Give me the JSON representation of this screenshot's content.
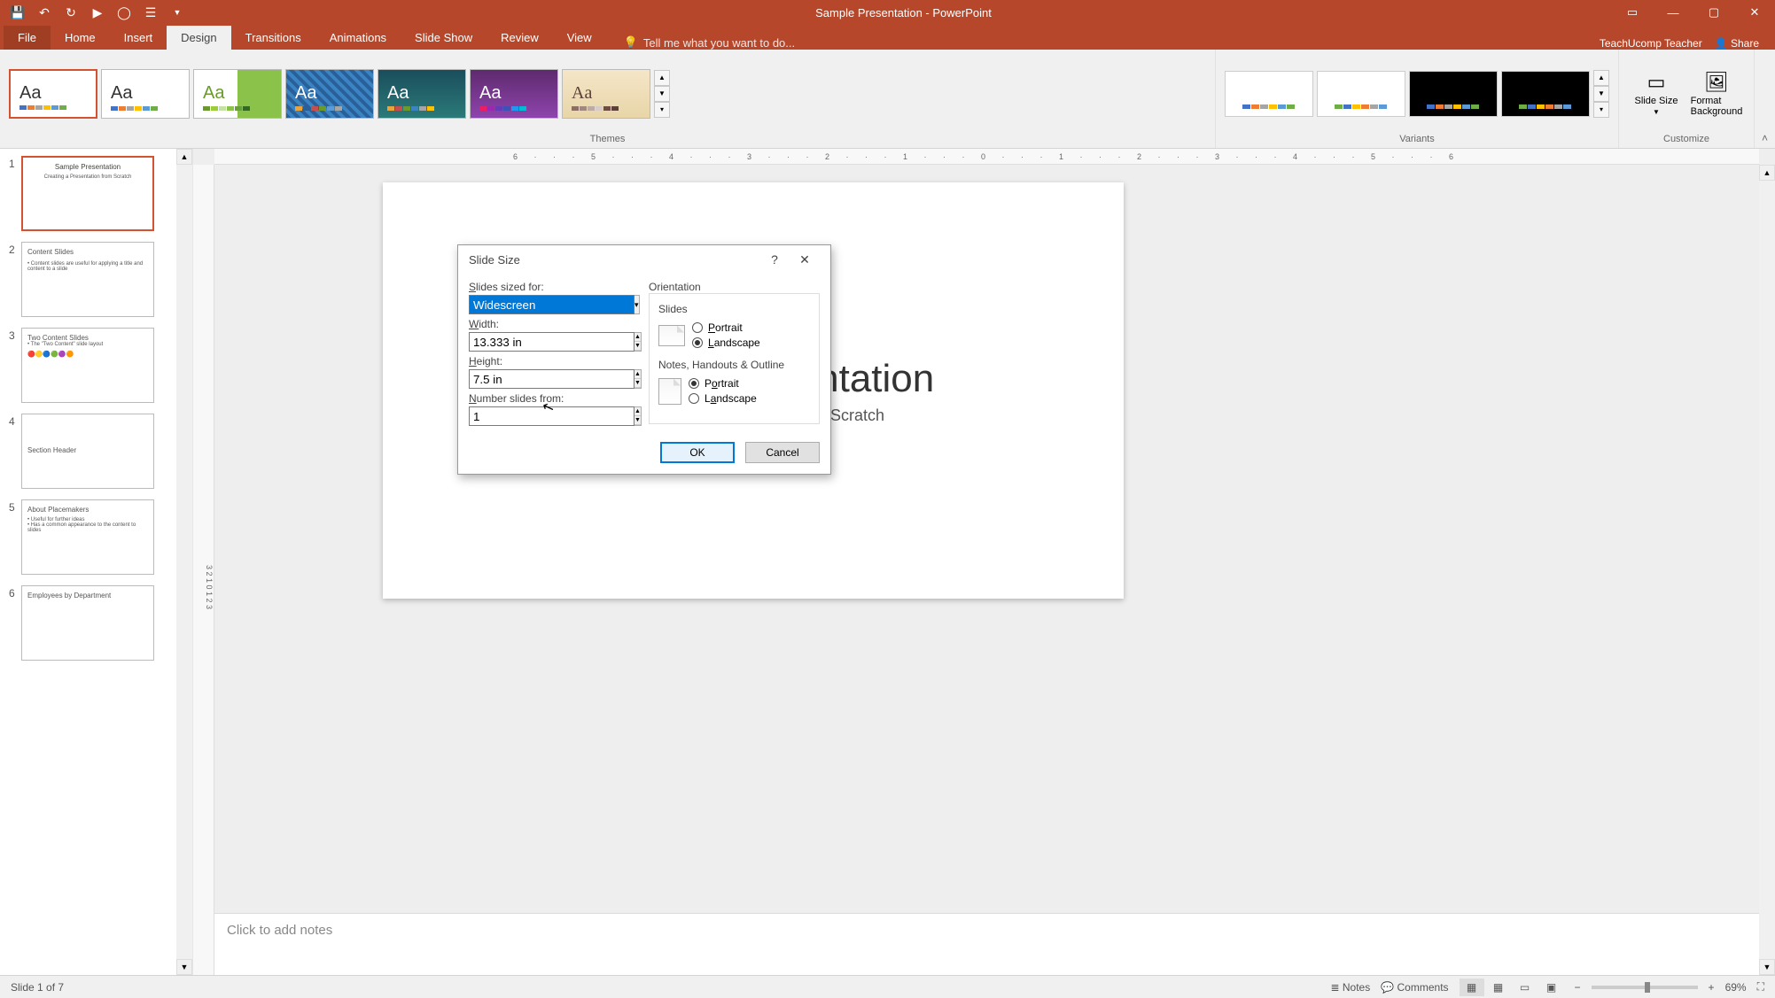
{
  "app": {
    "title": "Sample Presentation - PowerPoint"
  },
  "qat": [
    "save",
    "undo",
    "redo",
    "start-from-beginning",
    "circle",
    "touch-mode",
    "more"
  ],
  "tabs": {
    "file": "File",
    "home": "Home",
    "insert": "Insert",
    "design": "Design",
    "transitions": "Transitions",
    "animations": "Animations",
    "slideshow": "Slide Show",
    "review": "Review",
    "view": "View",
    "tellme": "Tell me what you want to do...",
    "active": "design"
  },
  "share": {
    "user": "TeachUcomp Teacher",
    "share": "Share"
  },
  "ribbon": {
    "themes_label": "Themes",
    "variants_label": "Variants",
    "customize_label": "Customize",
    "slide_size": "Slide Size",
    "format_bg": "Format Background"
  },
  "slide": {
    "title": "Sample Presentation",
    "subtitle": "Creating a Presentation from Scratch"
  },
  "thumbs": [
    {
      "n": "1",
      "title": "Sample Presentation"
    },
    {
      "n": "2",
      "title": "Content Slides"
    },
    {
      "n": "3",
      "title": "Two Content Slides"
    },
    {
      "n": "4",
      "title": "Section Header"
    },
    {
      "n": "5",
      "title": "About Placemakers"
    },
    {
      "n": "6",
      "title": "Employees by Department"
    }
  ],
  "notes_placeholder": "Click to add notes",
  "status": {
    "slide": "Slide 1 of 7",
    "notes": "Notes",
    "comments": "Comments",
    "zoom": "69%"
  },
  "dialog": {
    "title": "Slide Size",
    "sized_for_label": "Slides sized for:",
    "sized_for_value": "Widescreen",
    "width_label": "Width:",
    "width_value": "13.333 in",
    "height_label": "Height:",
    "height_value": "7.5 in",
    "number_label": "Number slides from:",
    "number_value": "1",
    "orientation": "Orientation",
    "slides": "Slides",
    "notes": "Notes, Handouts & Outline",
    "portrait": "Portrait",
    "landscape": "Landscape",
    "ok": "OK",
    "cancel": "Cancel"
  },
  "ruler_h": "6 · · · 5 · · · 4 · · · 3 · · · 2 · · · 1 · · · 0 · · · 1 · · · 2 · · · 3 · · · 4 · · · 5 · · · 6"
}
